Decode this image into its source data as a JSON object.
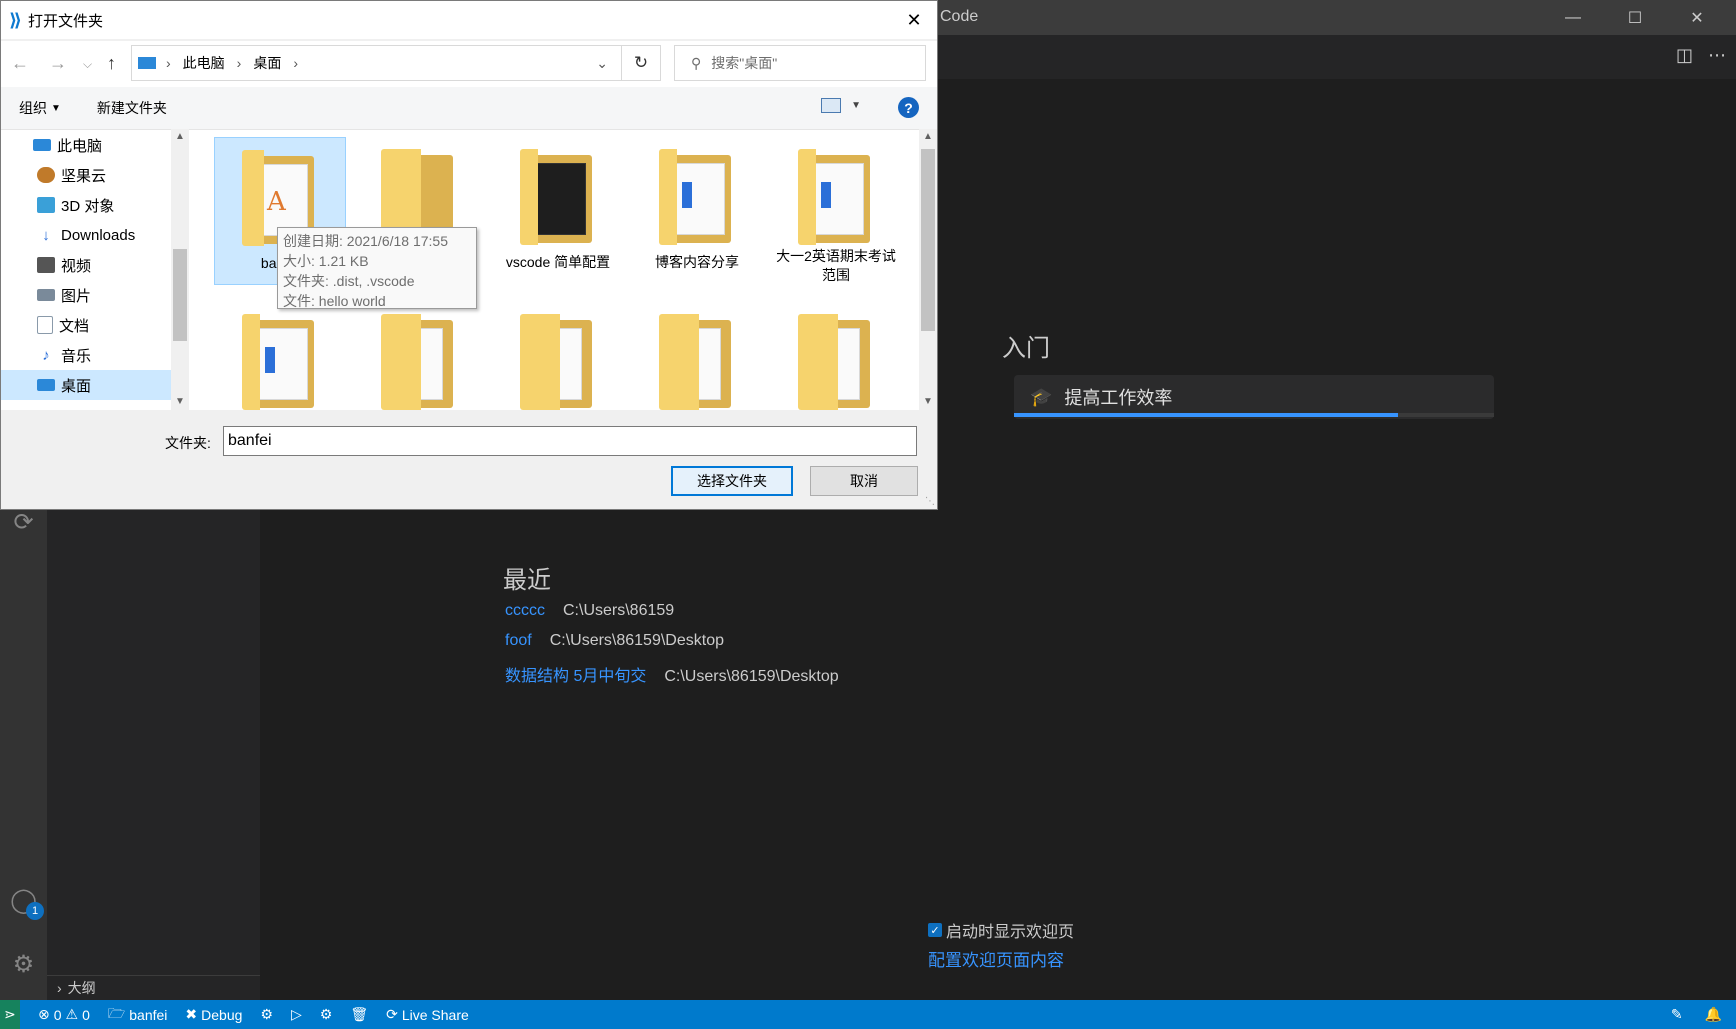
{
  "vscode": {
    "title_fragment": "Code",
    "getting_started": {
      "title": "入门",
      "card_label": "提高工作效率",
      "progress_fraction": 0.8
    },
    "recent": {
      "title": "最近",
      "items": [
        {
          "name": "ccccc",
          "path": "C:\\Users\\86159"
        },
        {
          "name": "foof",
          "path": "C:\\Users\\86159\\Desktop"
        },
        {
          "name": "数据结构 5月中旬交",
          "path": "C:\\Users\\86159\\Desktop"
        }
      ]
    },
    "startup_checkbox_label": "启动时显示欢迎页",
    "configure_link": "配置欢迎页面内容",
    "outline_label": "大纲",
    "account_badge": "1",
    "statusbar": {
      "errors": "0",
      "warnings": "0",
      "folder": "banfei",
      "debug": "Debug",
      "live_share": "Live Share"
    }
  },
  "dialog": {
    "title": "打开文件夹",
    "breadcrumb": [
      "此电脑",
      "桌面"
    ],
    "search_placeholder": "搜索\"桌面\"",
    "toolbar": {
      "organize": "组织",
      "new_folder": "新建文件夹",
      "help": "?"
    },
    "tree": [
      {
        "label": "此电脑",
        "icon": "pc-icon",
        "color": "#2b88d8"
      },
      {
        "label": "坚果云",
        "icon": "nutstore-icon",
        "color": "#c07a2a"
      },
      {
        "label": "3D 对象",
        "icon": "cube-icon",
        "color": "#3aa0d8"
      },
      {
        "label": "Downloads",
        "icon": "download-icon",
        "color": "#2b6fd8"
      },
      {
        "label": "视频",
        "icon": "video-icon",
        "color": "#555555"
      },
      {
        "label": "图片",
        "icon": "picture-icon",
        "color": "#7a8a9a"
      },
      {
        "label": "文档",
        "icon": "document-icon",
        "color": "#8a9aaa"
      },
      {
        "label": "音乐",
        "icon": "music-icon",
        "color": "#2b6fd8"
      },
      {
        "label": "桌面",
        "icon": "desktop-icon",
        "color": "#2b88d8"
      }
    ],
    "files": [
      {
        "label": "banfei"
      },
      {
        "label": "hello"
      },
      {
        "label": "vscode 简单配置"
      },
      {
        "label": "博客内容分享"
      },
      {
        "label": "大一2英语期末考试范围"
      }
    ],
    "tooltip": {
      "created": "创建日期: 2021/6/18 17:55",
      "size": "大小: 1.21 KB",
      "folders": "文件夹: .dist, .vscode",
      "files": "文件: hello world"
    },
    "filename_label": "文件夹:",
    "filename_value": "banfei",
    "select_button": "选择文件夹",
    "cancel_button": "取消"
  }
}
